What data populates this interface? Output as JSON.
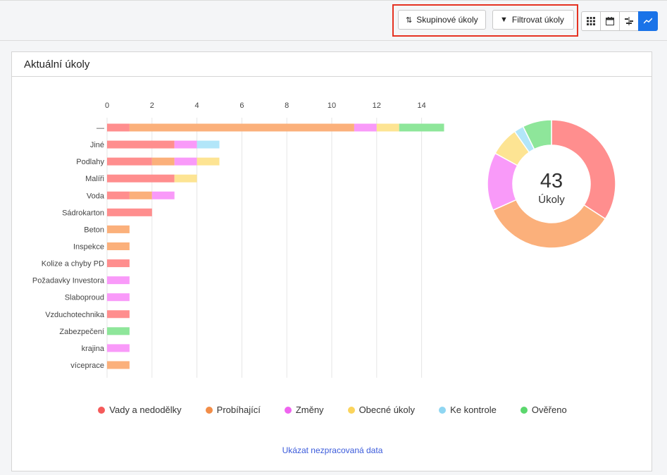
{
  "toolbar": {
    "group_tasks_label": "Skupinové úkoly",
    "filter_tasks_label": "Filtrovat úkoly",
    "view_buttons": [
      "grid-icon",
      "calendar-icon",
      "gantt-icon",
      "chart-icon"
    ],
    "active_view": "chart-icon",
    "highlight_color": "#e53222",
    "accent_color": "#1a73e8"
  },
  "card": {
    "title": "Aktuální úkoly",
    "raw_data_link": "Ukázat nezpracovaná data"
  },
  "legend_colors": {
    "Vady a nedodělky": "#f55a5a",
    "Probíhající": "#f28d48",
    "Změny": "#ef64ef",
    "Obecné úkoly": "#fbd45c",
    "Ke kontrole": "#8fd6f2",
    "Ověřeno": "#5bd76d"
  },
  "chart_data": [
    {
      "type": "bar",
      "orientation": "horizontal",
      "stacked": true,
      "x_ticks": [
        "0",
        "2",
        "4",
        "6",
        "8",
        "10",
        "12",
        "14"
      ],
      "xlim": [
        0,
        15
      ],
      "x_axis_position": "top",
      "grid": true,
      "categories": [
        "—",
        "Jiné",
        "Podlahy",
        "Malíři",
        "Voda",
        "Sádrokarton",
        "Beton",
        "Inspekce",
        "Kolize a chyby PD",
        "Požadavky Investora",
        "Slaboproud",
        "Vzduchotechnika",
        "Zabezpečení",
        "krajina",
        "víceprace"
      ],
      "series": [
        {
          "name": "Vady a nedodělky",
          "color": "#ff8e8e",
          "values": [
            1,
            3,
            2,
            3,
            1,
            2,
            0,
            0,
            1,
            0,
            0,
            1,
            0,
            0,
            0
          ]
        },
        {
          "name": "Probíhající",
          "color": "#fbb07b",
          "values": [
            10,
            0,
            1,
            0,
            1,
            0,
            1,
            1,
            0,
            0,
            0,
            0,
            0,
            0,
            1
          ]
        },
        {
          "name": "Změny",
          "color": "#f99af9",
          "values": [
            1,
            1,
            1,
            0,
            1,
            0,
            0,
            0,
            0,
            1,
            1,
            0,
            0,
            1,
            0
          ]
        },
        {
          "name": "Obecné úkoly",
          "color": "#fde493",
          "values": [
            1,
            0,
            1,
            1,
            0,
            0,
            0,
            0,
            0,
            0,
            0,
            0,
            0,
            0,
            0
          ]
        },
        {
          "name": "Ke kontrole",
          "color": "#b2e6f9",
          "values": [
            0,
            1,
            0,
            0,
            0,
            0,
            0,
            0,
            0,
            0,
            0,
            0,
            0,
            0,
            0
          ]
        },
        {
          "name": "Ověřeno",
          "color": "#8ee69a",
          "values": [
            2,
            0,
            0,
            0,
            0,
            0,
            0,
            0,
            0,
            0,
            0,
            0,
            1,
            0,
            0
          ]
        }
      ],
      "legend_position": "bottom"
    },
    {
      "type": "pie",
      "donut": true,
      "center_value": "43",
      "center_label": "Úkoly",
      "slices": [
        {
          "name": "Vady a nedodělky",
          "value": 14,
          "color": "#ff8e8e"
        },
        {
          "name": "Probíhající",
          "value": 14,
          "color": "#fbb07b"
        },
        {
          "name": "Změny",
          "value": 6,
          "color": "#f99af9"
        },
        {
          "name": "Obecné úkoly",
          "value": 3,
          "color": "#fde493"
        },
        {
          "name": "Ke kontrole",
          "value": 1,
          "color": "#b2e6f9"
        },
        {
          "name": "Ověřeno",
          "value": 3,
          "color": "#8ee69a"
        }
      ]
    }
  ],
  "legend": [
    "Vady a nedodělky",
    "Probíhající",
    "Změny",
    "Obecné úkoly",
    "Ke kontrole",
    "Ověřeno"
  ]
}
